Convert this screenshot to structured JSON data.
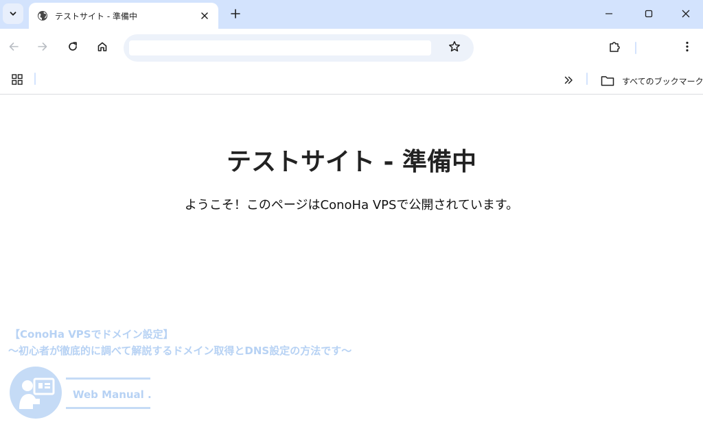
{
  "tab": {
    "title": "テストサイト - 準備中"
  },
  "toolbar": {
    "address_value": "",
    "address_placeholder": ""
  },
  "bookmarks": {
    "all_bookmarks_label": "すべてのブックマーク"
  },
  "page": {
    "heading": "テストサイト - 準備中",
    "welcome": "ようこそ！このページはConoHa VPSで公開されています。"
  },
  "watermark": {
    "title_line1": "【ConoHa VPSでドメイン設定】",
    "title_line2": "〜初心者が徹底的に調べて解説するドメイン取得とDNS設定の方法です〜",
    "brand": "Web Manual ."
  },
  "icons": {
    "tab_search": "chevron-down-icon",
    "favicon": "globe-icon",
    "tab_close": "close-icon",
    "new_tab": "plus-icon",
    "minimize": "minimize-icon",
    "maximize": "maximize-icon",
    "window_close": "close-icon",
    "back": "arrow-left-icon",
    "forward": "arrow-right-icon",
    "reload": "reload-icon",
    "home": "home-icon",
    "bookmark_star": "star-icon",
    "extensions": "puzzle-icon",
    "menu": "kebab-menu-icon",
    "apps": "apps-grid-icon",
    "overflow": "double-chevron-right-icon",
    "folder": "folder-icon"
  },
  "colors": {
    "tabstrip_bg": "#d3e3fd",
    "omnibox_bg": "#edf2fa",
    "watermark": "#b7d2f4"
  }
}
